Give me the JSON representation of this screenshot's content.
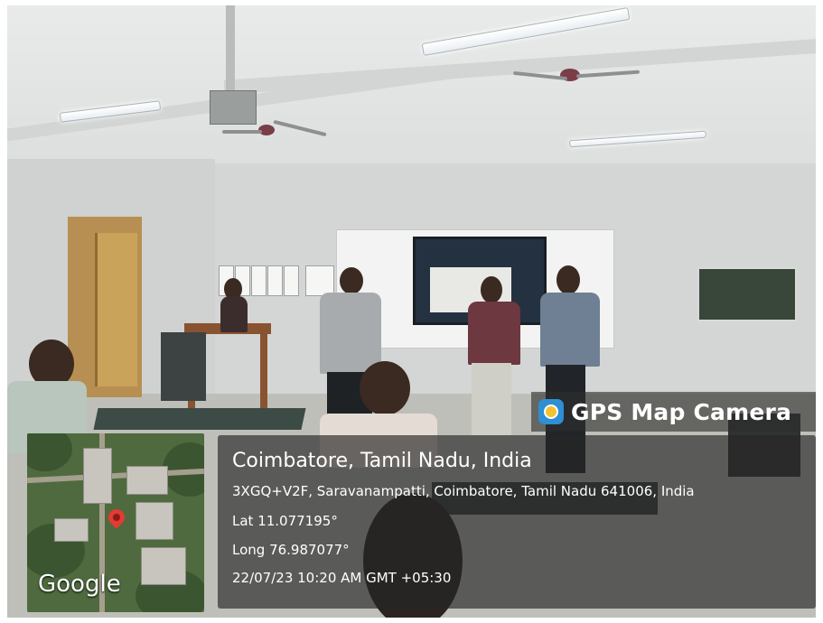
{
  "overlay": {
    "brand": "GPS Map Camera",
    "location_title": "Coimbatore, Tamil Nadu, India",
    "address": "3XGQ+V2F, Saravanampatti, Coimbatore, Tamil Nadu 641006, India",
    "latitude": "Lat 11.077195°",
    "longitude": "Long 76.987077°",
    "datetime": "22/07/23 10:20 AM GMT +05:30"
  },
  "map": {
    "provider_mark": "Google",
    "pin_color": "#e23b34"
  },
  "icons": {
    "brand_logo": "gps-map-camera-icon",
    "map_pin": "map-pin-icon"
  }
}
